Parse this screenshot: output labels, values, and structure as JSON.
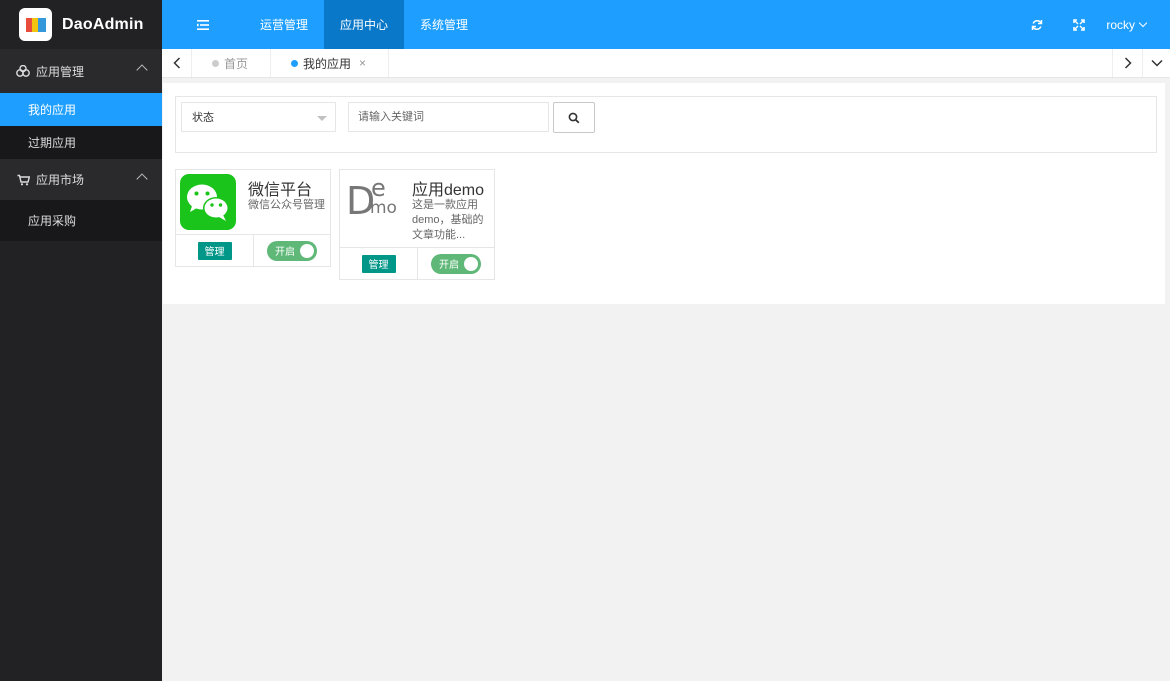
{
  "app": {
    "name": "DaoAdmin"
  },
  "sidebar": {
    "groups": [
      {
        "label": "应用管理",
        "items": [
          {
            "label": "我的应用"
          },
          {
            "label": "过期应用"
          }
        ]
      },
      {
        "label": "应用市场",
        "items": [
          {
            "label": "应用采购"
          }
        ]
      }
    ]
  },
  "header": {
    "nav": [
      {
        "label": "运营管理"
      },
      {
        "label": "应用中心"
      },
      {
        "label": "系统管理"
      }
    ],
    "user": "rocky"
  },
  "tabs": [
    {
      "label": "首页"
    },
    {
      "label": "我的应用"
    }
  ],
  "filter": {
    "status_label": "状态",
    "search_placeholder": "请输入关键词"
  },
  "apps": [
    {
      "title": "微信平台",
      "desc": "微信公众号管理",
      "manage": "管理",
      "toggle": "开启"
    },
    {
      "title": "应用demo",
      "desc": "这是一款应用demo，基础的文章功能...",
      "manage": "管理",
      "toggle": "开启"
    }
  ],
  "colors": {
    "primary": "#1e9fff",
    "nav_active": "#0a78c8",
    "sidebar": "#222224",
    "manage": "#009688",
    "switch_on": "#5fb878"
  }
}
